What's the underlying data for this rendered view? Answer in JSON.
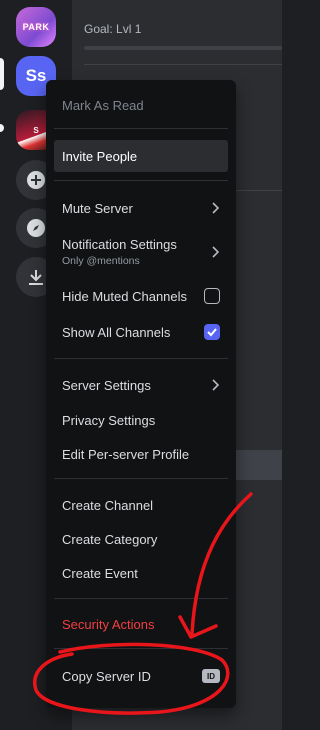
{
  "servers": {
    "park_label": "PARK",
    "ss_label": "Ss",
    "img_label": "S"
  },
  "channel": {
    "goal_label": "Goal: Lvl 1"
  },
  "menu": {
    "mark_as_read": "Mark As Read",
    "invite_people": "Invite People",
    "mute_server": "Mute Server",
    "notification_settings": "Notification Settings",
    "notification_sub": "Only @mentions",
    "hide_muted_channels": "Hide Muted Channels",
    "hide_muted_checked": false,
    "show_all_channels": "Show All Channels",
    "show_all_checked": true,
    "server_settings": "Server Settings",
    "privacy_settings": "Privacy Settings",
    "edit_profile": "Edit Per-server Profile",
    "create_channel": "Create Channel",
    "create_category": "Create Category",
    "create_event": "Create Event",
    "security_actions": "Security Actions",
    "copy_server_id": "Copy Server ID",
    "id_badge": "ID"
  },
  "colors": {
    "accent": "#5865f2",
    "danger": "#f23f43",
    "annotation": "#e8161a"
  }
}
